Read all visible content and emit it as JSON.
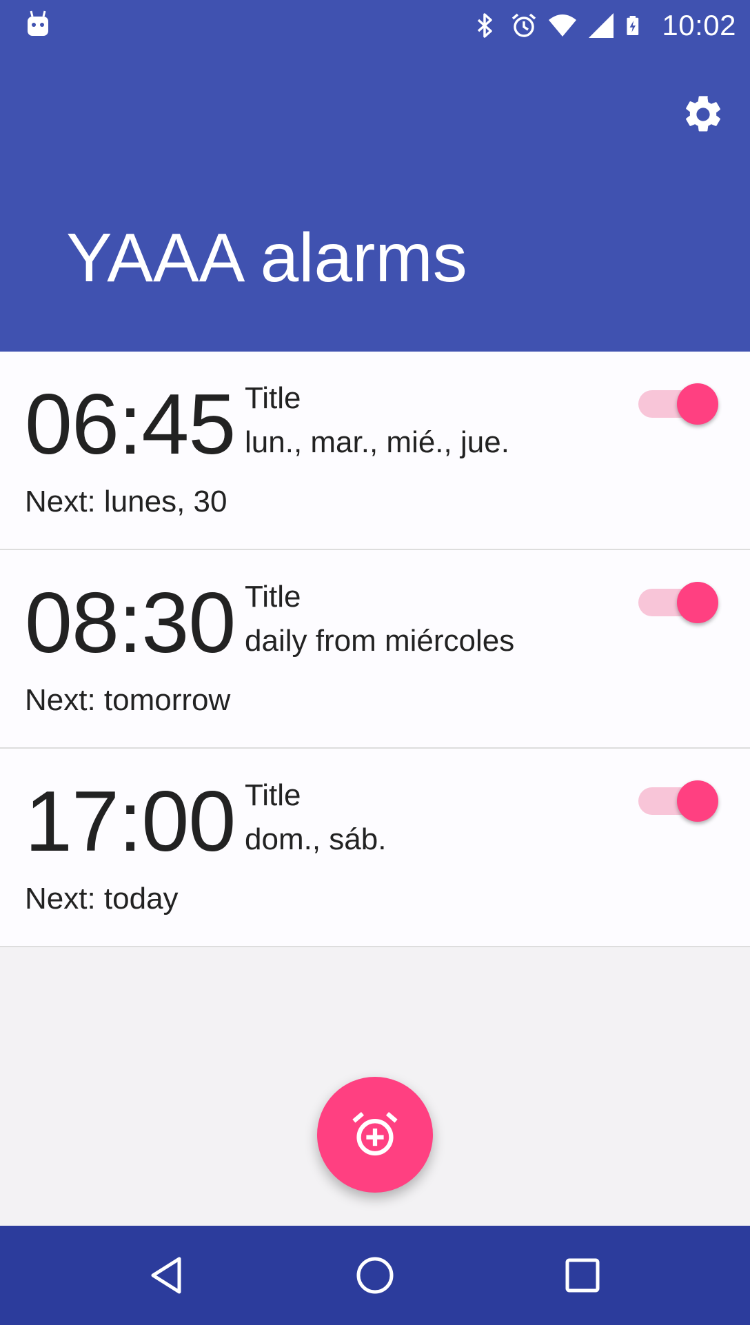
{
  "status_bar": {
    "time": "10:02",
    "icons": [
      "android-debug-icon",
      "bluetooth-icon",
      "alarm-icon",
      "wifi-icon",
      "signal-icon",
      "battery-charging-icon"
    ]
  },
  "app_bar": {
    "title": "YAAA alarms",
    "settings_icon": "gear-icon"
  },
  "alarms": [
    {
      "time": "06:45",
      "title": "Title",
      "days": "lun., mar., mié., jue.",
      "next": "Next: lunes, 30",
      "enabled": true
    },
    {
      "time": "08:30",
      "title": "Title",
      "days": "daily from miércoles",
      "next": "Next: tomorrow",
      "enabled": true
    },
    {
      "time": "17:00",
      "title": "Title",
      "days": "dom., sáb.",
      "next": "Next: today",
      "enabled": true
    }
  ],
  "fab": {
    "icon": "add-alarm-icon"
  },
  "nav_bar": {
    "buttons": [
      "back-icon",
      "home-icon",
      "recents-icon"
    ]
  },
  "colors": {
    "primary": "#4052b0",
    "primary_dark": "#2c3c9c",
    "accent": "#ff4081",
    "toggle_track": "#f8c5d8",
    "card_background": "#fdfcff",
    "window_background": "#f3f2f4"
  }
}
